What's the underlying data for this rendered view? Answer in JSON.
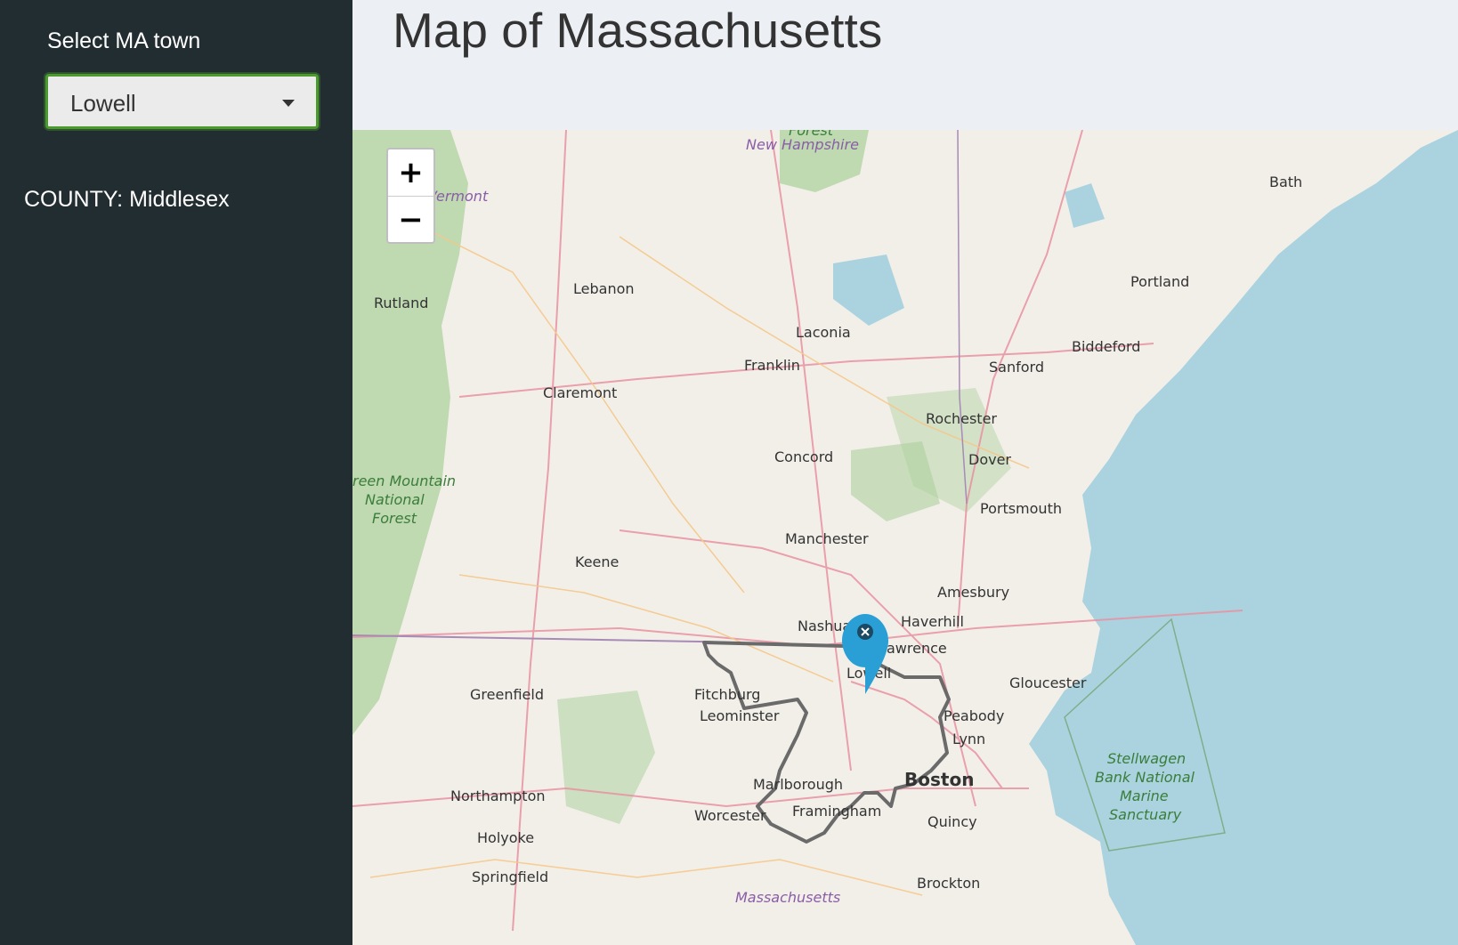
{
  "sidebar": {
    "select_label": "Select MA town",
    "selected_town": "Lowell",
    "county_text": "COUNTY: Middlesex"
  },
  "header": {
    "title": "Map of Massachusetts"
  },
  "map": {
    "zoom_in_label": "+",
    "zoom_out_label": "−",
    "marker_icon": "map-pin-icon",
    "colors": {
      "land": "#f2efe9",
      "water": "#aad3df",
      "forest": "#add19e",
      "boundary": "#666666",
      "marker": "#2a9fd6"
    },
    "labels": {
      "forest": "Forest",
      "new_hampshire": "New Hampshire",
      "vermont": "Vermont",
      "bath": "Bath",
      "rutland": "Rutland",
      "lebanon": "Lebanon",
      "portland": "Portland",
      "laconia": "Laconia",
      "biddeford": "Biddeford",
      "franklin": "Franklin",
      "sanford": "Sanford",
      "claremont": "Claremont",
      "rochester": "Rochester",
      "concord": "Concord",
      "dover": "Dover",
      "green_mountain_1": "reen Mountain",
      "green_mountain_2": "National",
      "green_mountain_3": "Forest",
      "portsmouth": "Portsmouth",
      "manchester": "Manchester",
      "keene": "Keene",
      "amesbury": "Amesbury",
      "nashua": "Nashua",
      "haverhill": "Haverhill",
      "lawrence": "awrence",
      "lowell": "Lowell",
      "gloucester": "Gloucester",
      "greenfield": "Greenfield",
      "fitchburg": "Fitchburg",
      "leominster": "Leominster",
      "peabody": "Peabody",
      "lynn": "Lynn",
      "stellwagen_1": "Stellwagen",
      "stellwagen_2": "Bank National",
      "stellwagen_3": "Marine",
      "stellwagen_4": "Sanctuary",
      "northampton": "Northampton",
      "marlborough": "Marlborough",
      "boston": "Boston",
      "worcester": "Worcester",
      "framingham": "Framingham",
      "quincy": "Quincy",
      "holyoke": "Holyoke",
      "springfield": "Springfield",
      "brockton": "Brockton",
      "massachusetts": "Massachusetts"
    }
  }
}
